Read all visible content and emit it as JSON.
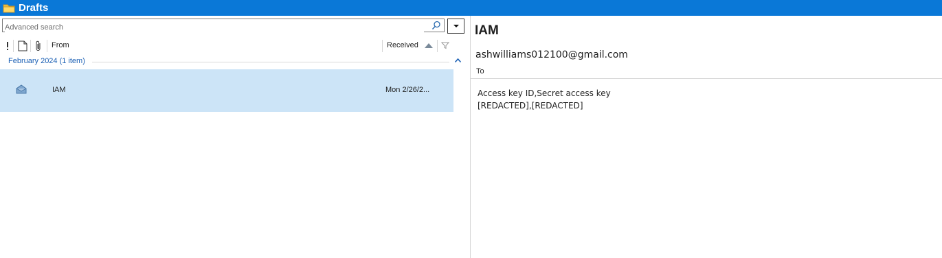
{
  "window": {
    "title": "Drafts",
    "icon": "folder-icon"
  },
  "search": {
    "placeholder": "Advanced search",
    "value": ""
  },
  "columns": {
    "importance_icon": "importance-icon",
    "type_icon": "document-icon",
    "attachment_icon": "paperclip-icon",
    "from": "From",
    "received": "Received",
    "sort_direction": "ascending"
  },
  "group": {
    "label": "February 2024 (1 item)"
  },
  "messages": [
    {
      "subject": "IAM",
      "received": "Mon 2/26/2...",
      "selected": true,
      "icon": "envelope-icon"
    }
  ],
  "reading_pane": {
    "subject": "IAM",
    "sender": "ashwilliams012100@gmail.com",
    "to_label": "To",
    "body_lines": [
      "Access key ID,Secret access key",
      "[REDACTED],[REDACTED]"
    ]
  },
  "colors": {
    "titlebar": "#0a78d7",
    "selection": "#cce4f7",
    "group_label": "#1a5fb4"
  }
}
